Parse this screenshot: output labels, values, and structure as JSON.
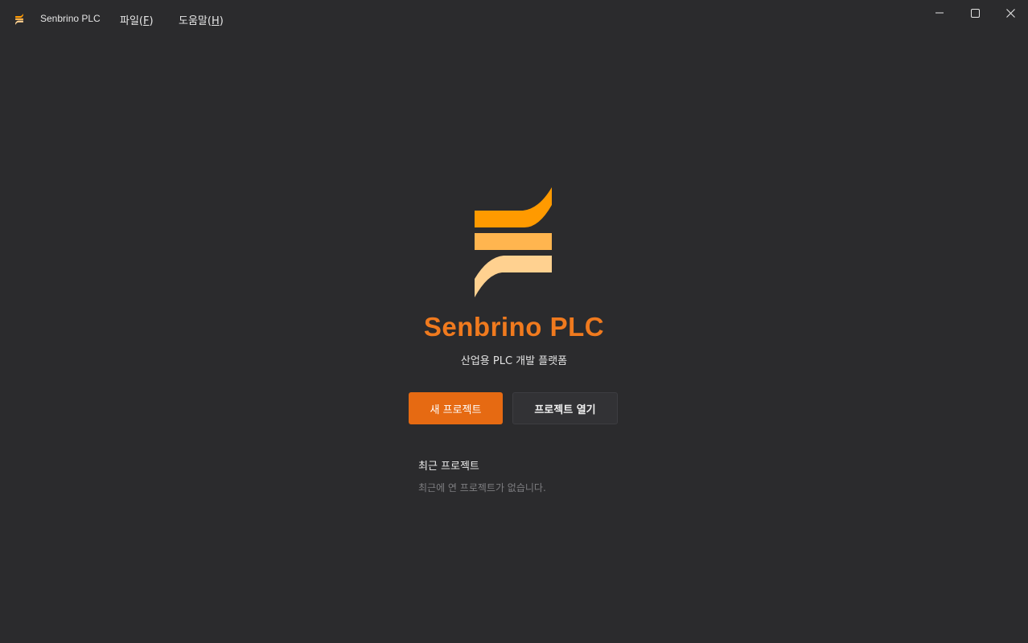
{
  "app": {
    "title": "Senbrino PLC",
    "icon": "senbrino-logo-icon"
  },
  "menu": {
    "file_label": "파일(",
    "file_accel": "F",
    "file_suffix": ")",
    "help_label": "도움말(",
    "help_accel": "H",
    "help_suffix": ")"
  },
  "window_controls": {
    "minimize": "minimize-icon",
    "maximize": "maximize-icon",
    "close": "close-icon"
  },
  "welcome": {
    "product_name": "Senbrino PLC",
    "tagline": "산업용 PLC 개발 플랫폼",
    "new_project_label": "새 프로젝트",
    "open_project_label": "프로젝트 열기"
  },
  "recent": {
    "title": "최근 프로젝트",
    "empty_text": "최근에 연 프로젝트가 없습니다."
  },
  "colors": {
    "background": "#2b2b2d",
    "accent": "#e66a12",
    "brand_text": "#f07a1e",
    "logo_top": "#ff9a00",
    "logo_mid": "#ffb54f",
    "logo_bottom": "#ffd190"
  }
}
